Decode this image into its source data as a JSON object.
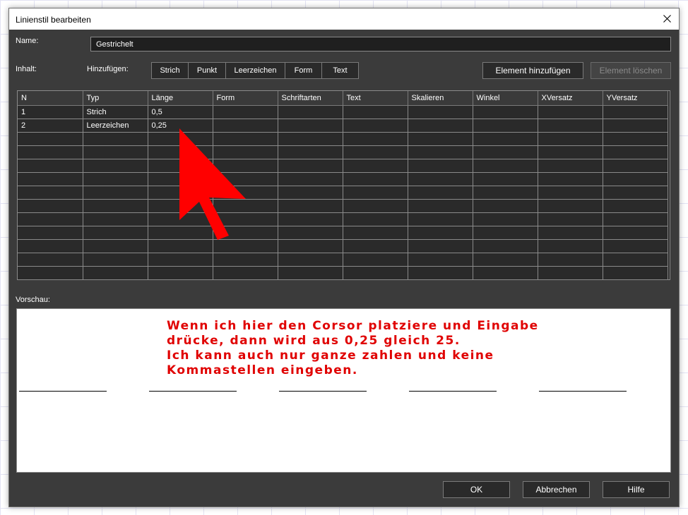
{
  "window": {
    "title": "Linienstil bearbeiten"
  },
  "name_field": {
    "label": "Name:",
    "value": "Gestrichelt"
  },
  "inhalt": {
    "label": "Inhalt:"
  },
  "hinzufuegen": {
    "label": "Hinzufügen:",
    "buttons": [
      "Strich",
      "Punkt",
      "Leerzeichen",
      "Form",
      "Text"
    ]
  },
  "actions": {
    "add_element": "Element hinzufügen",
    "delete_element": "Element löschen"
  },
  "table": {
    "columns": [
      "N",
      "Typ",
      "Länge",
      "Form",
      "Schriftarten",
      "Text",
      "Skalieren",
      "Winkel",
      "XVersatz",
      "YVersatz"
    ],
    "rows": [
      [
        "1",
        "Strich",
        "0,5",
        "",
        "",
        "",
        "",
        "",
        "",
        ""
      ],
      [
        "2",
        "Leerzeichen",
        "0,25",
        "",
        "",
        "",
        "",
        "",
        "",
        ""
      ]
    ]
  },
  "preview": {
    "label": "Vorschau:"
  },
  "annotation": {
    "lines": [
      "Wenn ich hier den Corsor platziere und Eingabe",
      "drücke, dann wird aus 0,25 gleich 25.",
      "Ich kann auch nur ganze zahlen und keine",
      "Kommastellen eingeben."
    ],
    "color": "#e00000"
  },
  "footer": {
    "ok": "OK",
    "cancel": "Abbrechen",
    "help": "Hilfe"
  }
}
